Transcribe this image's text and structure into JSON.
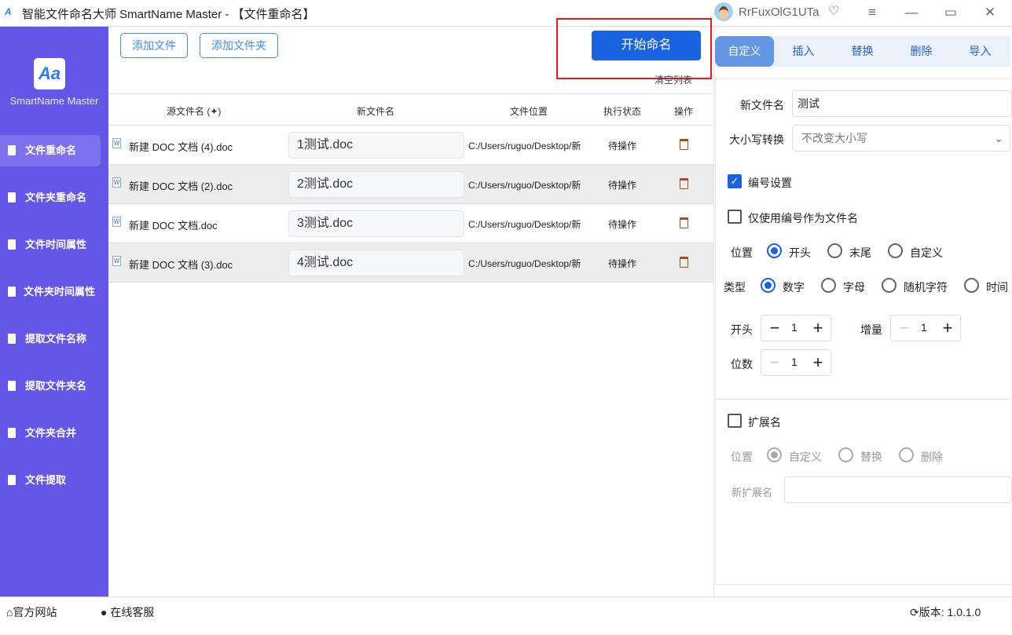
{
  "window": {
    "title": "智能文件命名大师 SmartName Master - 【文件重命名】",
    "username": "RrFuxOlG1UTa",
    "logo_text": "Aa"
  },
  "sidebar": {
    "app_name": "SmartName Master",
    "items": [
      {
        "label": "文件重命名",
        "active": true
      },
      {
        "label": "文件夹重命名"
      },
      {
        "label": "文件时间属性"
      },
      {
        "label": "文件夹时间属性"
      },
      {
        "label": "提取文件名称"
      },
      {
        "label": "提取文件夹名"
      },
      {
        "label": "文件夹合并"
      },
      {
        "label": "文件提取"
      }
    ]
  },
  "toolbar": {
    "add_file": "添加文件",
    "add_folder": "添加文件夹",
    "start": "开始命名",
    "clear": "清空列表"
  },
  "table": {
    "headers": [
      "源文件名 (✦)",
      "新文件名",
      "文件位置",
      "执行状态",
      "操作"
    ],
    "rows": [
      {
        "src": "新建 DOC 文档 (4).doc",
        "new": "1测试.doc",
        "path": "C:/Users/ruguo/Desktop/新",
        "status": "待操作"
      },
      {
        "src": "新建 DOC 文档 (2).doc",
        "new": "2测试.doc",
        "path": "C:/Users/ruguo/Desktop/新",
        "status": "待操作"
      },
      {
        "src": "新建 DOC 文档.doc",
        "new": "3测试.doc",
        "path": "C:/Users/ruguo/Desktop/新",
        "status": "待操作"
      },
      {
        "src": "新建 DOC 文档 (3).doc",
        "new": "4测试.doc",
        "path": "C:/Users/ruguo/Desktop/新",
        "status": "待操作"
      }
    ]
  },
  "tabs": [
    "自定义",
    "插入",
    "替换",
    "删除",
    "导入"
  ],
  "panel": {
    "new_name_label": "新文件名",
    "new_name_value": "测试",
    "case_label": "大小写转换",
    "case_value": "不改变大小写",
    "numbering_label": "编号设置",
    "numbering_checked": true,
    "only_number_label": "仅使用编号作为文件名",
    "position_label": "位置",
    "position_options": [
      "开头",
      "末尾",
      "自定义"
    ],
    "type_label": "类型",
    "type_options": [
      "数字",
      "字母",
      "随机字符",
      "时间"
    ],
    "start_label": "开头",
    "start_value": "1",
    "increment_label": "增量",
    "increment_value": "1",
    "digits_label": "位数",
    "digits_value": "1",
    "ext_label": "扩展名",
    "ext_position_label": "位置",
    "ext_options": [
      "自定义",
      "替换",
      "删除"
    ],
    "new_ext_label": "新扩展名"
  },
  "footer": {
    "website": "官方网站",
    "support": "在线客服",
    "version_label": "版本:",
    "version": "1.0.1.0"
  }
}
